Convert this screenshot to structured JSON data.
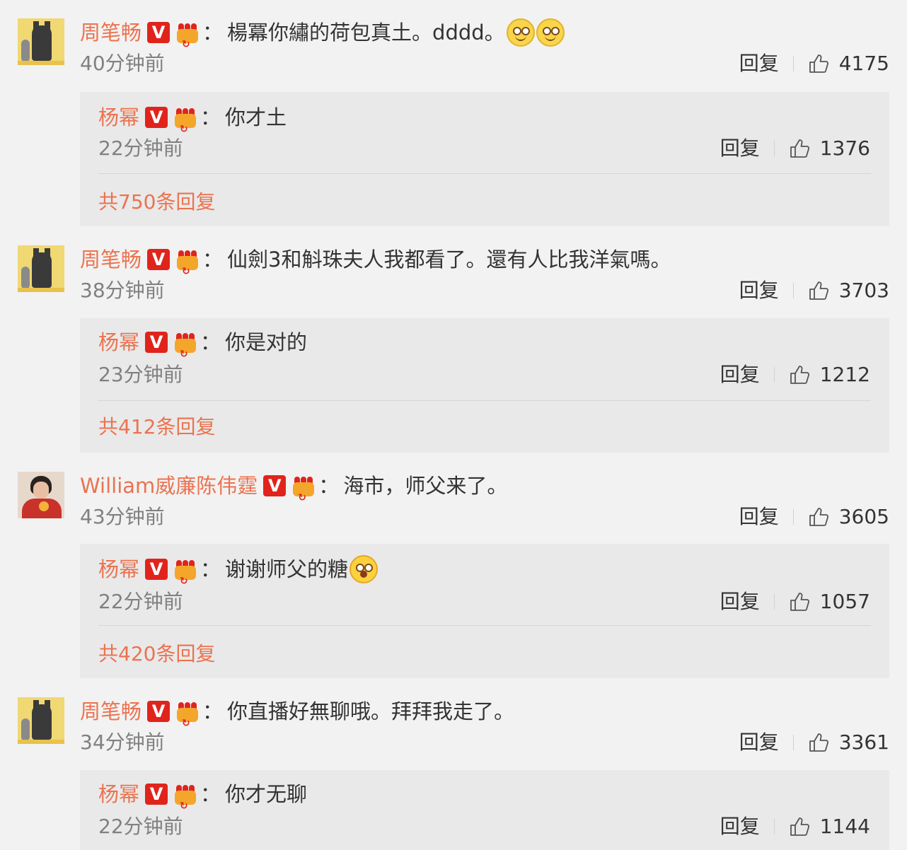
{
  "comments": [
    {
      "name": "周笔畅",
      "badge": "V",
      "text": "楊冪你繡的荷包真土。dddd。",
      "time": "40分钟前",
      "reply_label": "回复",
      "likes": "4175",
      "reply": {
        "name": "杨幂",
        "badge": "V",
        "text": "你才土",
        "time": "22分钟前",
        "reply_label": "回复",
        "likes": "1376"
      },
      "total": "共750条回复"
    },
    {
      "name": "周笔畅",
      "badge": "V",
      "text": "仙劍3和斛珠夫人我都看了。還有人比我洋氣嗎。",
      "time": "38分钟前",
      "reply_label": "回复",
      "likes": "3703",
      "reply": {
        "name": "杨幂",
        "badge": "V",
        "text": "你是对的",
        "time": "23分钟前",
        "reply_label": "回复",
        "likes": "1212"
      },
      "total": "共412条回复"
    },
    {
      "name": "William威廉陈伟霆",
      "badge": "V",
      "text": "海市，师父来了。",
      "time": "43分钟前",
      "reply_label": "回复",
      "likes": "3605",
      "reply": {
        "name": "杨幂",
        "badge": "V",
        "text": "谢谢师父的糖",
        "time": "22分钟前",
        "reply_label": "回复",
        "likes": "1057"
      },
      "total": "共420条回复"
    },
    {
      "name": "周笔畅",
      "badge": "V",
      "text": "你直播好無聊哦。拜拜我走了。",
      "time": "34分钟前",
      "reply_label": "回复",
      "likes": "3361",
      "reply": {
        "name": "杨幂",
        "badge": "V",
        "text": "你才无聊",
        "time": "22分钟前",
        "reply_label": "回复",
        "likes": "1144"
      }
    }
  ],
  "colors": {
    "name": "#eb7350",
    "badge": "#e0241c",
    "background": "#f2f2f2",
    "reply_background": "#e9e9e9"
  },
  "icons": [
    "avatar",
    "verified-badge",
    "vip-crown-icon",
    "smile-emoji-icon",
    "surprised-emoji-icon",
    "thumbs-up-icon"
  ]
}
